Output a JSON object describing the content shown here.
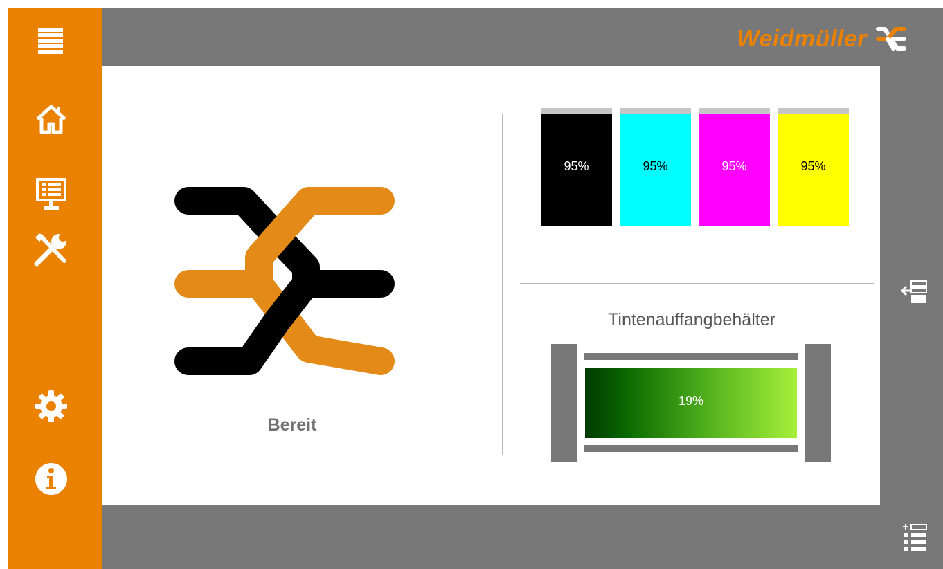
{
  "header": {
    "brand_name": "Weidmüller"
  },
  "sidebar": {
    "items": [
      {
        "icon": "menu-icon"
      },
      {
        "icon": "home-icon"
      },
      {
        "icon": "monitor-icon"
      },
      {
        "icon": "tools-icon"
      },
      {
        "icon": "gear-icon"
      },
      {
        "icon": "info-icon"
      }
    ]
  },
  "main": {
    "status": "Bereit",
    "inks": [
      {
        "color": "#000000",
        "level": "95%",
        "text_color": "#ffffff"
      },
      {
        "color": "#00ffff",
        "level": "95%",
        "text_color": "#000000"
      },
      {
        "color": "#ff00ff",
        "level": "95%",
        "text_color": "#ffffff"
      },
      {
        "color": "#ffff00",
        "level": "95%",
        "text_color": "#000000"
      }
    ],
    "tank": {
      "title": "Tintenauffangbehälter",
      "level": "19%"
    }
  },
  "colors": {
    "accent": "#ea8200",
    "frame": "#787878"
  },
  "right_panel": {
    "icons": [
      "collapse-panel-icon",
      "list-settings-icon"
    ]
  }
}
